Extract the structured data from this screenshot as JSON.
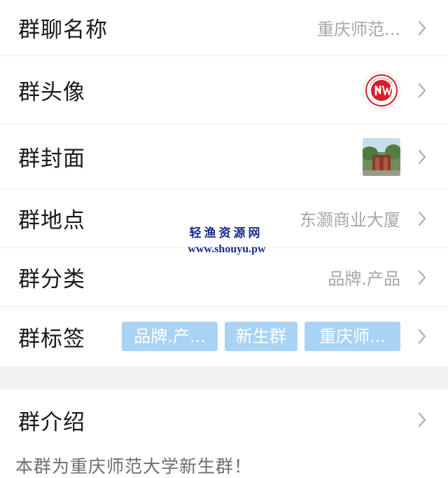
{
  "rows": {
    "name": {
      "label": "群聊名称",
      "value": "重庆师范..."
    },
    "avatar": {
      "label": "群头像"
    },
    "cover": {
      "label": "群封面"
    },
    "location": {
      "label": "群地点",
      "value": "东灏商业大厦"
    },
    "category": {
      "label": "群分类",
      "value": "品牌.产品"
    },
    "tags": {
      "label": "群标签",
      "items": [
        "品牌.产...",
        "新生群",
        "重庆师..."
      ]
    }
  },
  "intro": {
    "label": "群介绍",
    "text": "本群为重庆师范大学新生群！"
  },
  "watermark": {
    "title": "轻渔资源网",
    "url": "www.shouyu.pw"
  },
  "colors": {
    "tag_bg": "#a9d3f4",
    "logo_red": "#d61f2b",
    "watermark": "#1b2b8f",
    "separator": "#f2f2f4"
  },
  "icons": {
    "chevron": "chevron-right-icon",
    "avatar": "university-logo-icon",
    "cover": "campus-photo-thumbnail"
  }
}
